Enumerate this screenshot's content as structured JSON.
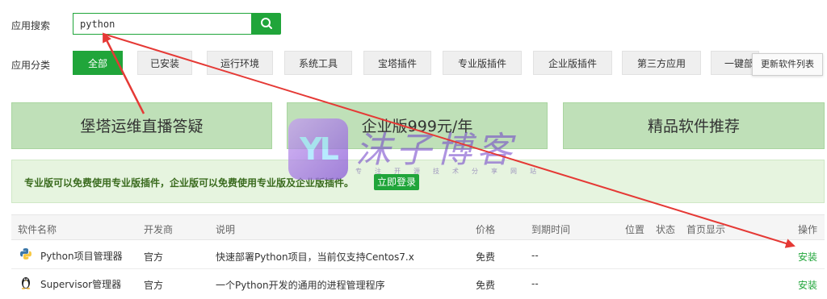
{
  "search": {
    "label": "应用搜索",
    "value": "python"
  },
  "category": {
    "label": "应用分类",
    "tabs": [
      "全部",
      "已安装",
      "运行环境",
      "系统工具",
      "宝塔插件",
      "专业版插件",
      "企业版插件",
      "第三方应用",
      "一键部"
    ],
    "active_index": 0,
    "refresh_label": "更新软件列表"
  },
  "banners": [
    "堡塔运维直播答疑",
    "企业版999元/年",
    "精品软件推荐"
  ],
  "promo": {
    "text": "专业版可以免费使用专业版插件，企业版可以免费使用专业版及企业版插件。",
    "login_label": "立即登录"
  },
  "table": {
    "headers": [
      "软件名称",
      "开发商",
      "说明",
      "价格",
      "到期时间",
      "位置",
      "状态",
      "首页显示",
      "操作"
    ],
    "rows": [
      {
        "name": "Python项目管理器",
        "developer": "官方",
        "description": "快速部署Python项目，当前仅支持Centos7.x",
        "price": "免费",
        "expiry": "--",
        "action": "安装",
        "icon": "python-logo-icon"
      },
      {
        "name": "Supervisor管理器",
        "developer": "官方",
        "description": "一个Python开发的通用的进程管理程序",
        "price": "免费",
        "expiry": "--",
        "action": "安装",
        "icon": "linux-penguin-icon"
      }
    ]
  },
  "watermark": {
    "logo_text": "YL",
    "title": "沫子博客",
    "subtitle": "专注开源技术分享网站"
  },
  "colors": {
    "accent": "#20a53a",
    "banner_bg": "#bfe0b8",
    "promo_bg": "#e6f4df",
    "annotation_arrow": "#e53935"
  }
}
